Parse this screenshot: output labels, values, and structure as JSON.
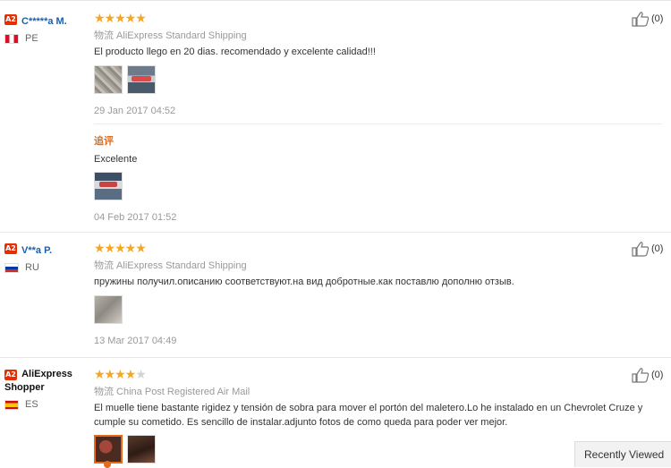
{
  "reviews": [
    {
      "badge": "A2",
      "username": "C*****a M.",
      "country": "PE",
      "stars_filled": 5,
      "stars_display": "★★★★★",
      "stars_empty_display": "",
      "shipping": "物流 AliExpress Standard Shipping",
      "text": "El producto llego en 20 dias. recomendado y excelente calidad!!!",
      "date": "29 Jan 2017 04:52",
      "likes": "(0)",
      "additional": {
        "label": "追评",
        "text": "Excelente",
        "date": "04 Feb 2017 01:52"
      }
    },
    {
      "badge": "A2",
      "username": "V**a P.",
      "country": "RU",
      "stars_filled": 5,
      "stars_display": "★★★★★",
      "stars_empty_display": "",
      "shipping": "物流 AliExpress Standard Shipping",
      "text": "пружины получил.описанию соответствуют.на вид добротные.как поставлю дополню отзыв.",
      "date": "13 Mar 2017 04:49",
      "likes": "(0)"
    },
    {
      "badge": "A2",
      "username": "AliExpress Shopper",
      "country": "ES",
      "stars_filled": 4,
      "stars_display": "★★★★",
      "stars_empty_display": "★",
      "shipping": "物流 China Post Registered Air Mail",
      "text": "El muelle tiene bastante rigidez y tensión de sobra para mover el portón del maletero.Lo he instalado en un Chevrolet Cruze y cumple su cometido. Es sencillo de instalar.adjunto fotos de como queda para poder ver mejor.",
      "likes": "(0)"
    }
  ],
  "recently_viewed": "Recently Viewed",
  "icons": {
    "like": "thumbs-up-icon",
    "flag_pe": "peru-flag-icon",
    "flag_ru": "russia-flag-icon",
    "flag_es": "spain-flag-icon"
  },
  "colors": {
    "star": "#f5a623",
    "badge": "#e62e04",
    "username_blue": "#1c5fa8",
    "additional_label": "#e26b1c"
  }
}
